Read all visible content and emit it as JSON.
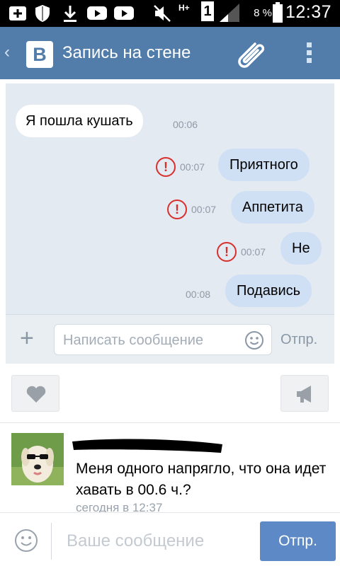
{
  "status_bar": {
    "battery_percent": "8 %",
    "signal_label": "1",
    "network_label": "H+",
    "time": "12:37"
  },
  "header": {
    "title": "Запись на стене",
    "logo_letter": "В",
    "accent_color": "#527daa"
  },
  "chat": {
    "messages": [
      {
        "direction": "in",
        "text": "Я пошла кушать",
        "time": "00:06",
        "error": false
      },
      {
        "direction": "out",
        "text": "Приятного",
        "time": "00:07",
        "error": true
      },
      {
        "direction": "out",
        "text": "Аппетита",
        "time": "00:07",
        "error": true
      },
      {
        "direction": "out",
        "text": "Не",
        "time": "00:07",
        "error": true
      },
      {
        "direction": "out",
        "text": "Подавись",
        "time": "00:08",
        "error": false
      }
    ],
    "compose_placeholder": "Написать сообщение",
    "compose_send": "Отпр."
  },
  "actions": {
    "like_icon": "heart-icon",
    "share_icon": "megaphone-icon"
  },
  "comment": {
    "text": "Меня одного напрягло, что она идет хавать в 00.6 ч.?",
    "date": "сегодня в 12:37"
  },
  "bottom_bar": {
    "placeholder": "Ваше сообщение",
    "send_label": "Отпр."
  }
}
